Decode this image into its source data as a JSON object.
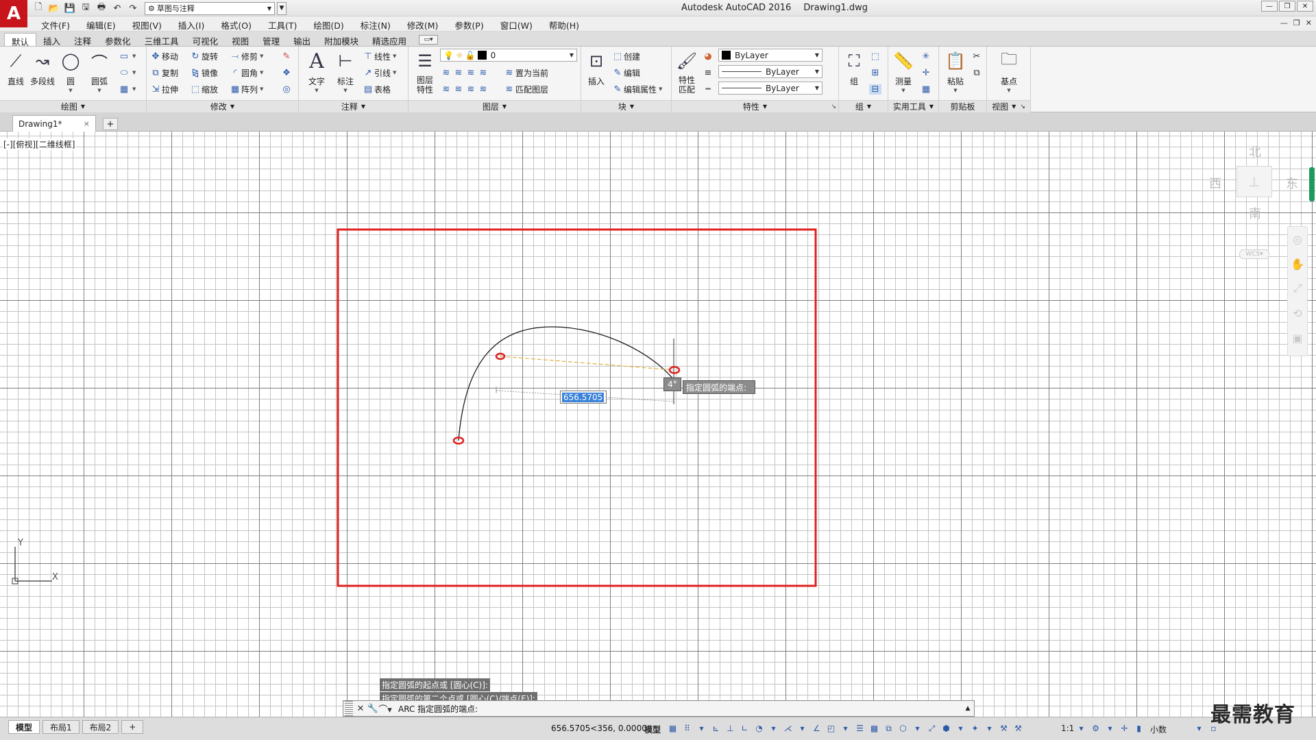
{
  "app": {
    "logo": "A",
    "title_app": "Autodesk AutoCAD 2016",
    "title_file": "Drawing1.dwg",
    "workspace": "草图与注释"
  },
  "menus": [
    "文件(F)",
    "编辑(E)",
    "视图(V)",
    "插入(I)",
    "格式(O)",
    "工具(T)",
    "绘图(D)",
    "标注(N)",
    "修改(M)",
    "参数(P)",
    "窗口(W)",
    "帮助(H)"
  ],
  "ribbon_tabs": [
    "默认",
    "插入",
    "注释",
    "参数化",
    "三维工具",
    "可视化",
    "视图",
    "管理",
    "输出",
    "附加模块",
    "精选应用"
  ],
  "ribbon": {
    "draw": {
      "title": "绘图",
      "line": "直线",
      "polyline": "多段线",
      "circle": "圆",
      "arc": "圆弧"
    },
    "modify": {
      "title": "修改",
      "move": "移动",
      "rotate": "旋转",
      "trim": "修剪",
      "copy": "复制",
      "mirror": "镜像",
      "fillet": "圆角",
      "stretch": "拉伸",
      "scale": "缩放",
      "array": "阵列"
    },
    "annotation": {
      "title": "注释",
      "text": "文字",
      "dimension": "标注",
      "linear": "线性",
      "leader": "引线",
      "table": "表格"
    },
    "layers": {
      "title": "图层",
      "properties_line1": "图层",
      "properties_line2": "特性",
      "current_layer": "0",
      "set_current": "置为当前",
      "match_layer": "匹配图层"
    },
    "block": {
      "title": "块",
      "insert": "插入",
      "create": "创建",
      "edit": "编辑",
      "edit_attr": "编辑属性"
    },
    "properties": {
      "title": "特性",
      "match_line1": "特性",
      "match_line2": "匹配",
      "color": "ByLayer",
      "linetype": "ByLayer",
      "lineweight": "ByLayer"
    },
    "groups": {
      "title": "组",
      "group": "组"
    },
    "utilities": {
      "title": "实用工具",
      "measure": "测量"
    },
    "clipboard": {
      "title": "剪贴板",
      "paste": "粘贴"
    },
    "view": {
      "title": "视图",
      "base": "基点"
    }
  },
  "file_tab": {
    "name": "Drawing1*",
    "close": "×",
    "new": "+"
  },
  "viewport": {
    "label": "[-][俯视][二维线框]",
    "dyn_value": "656.5705",
    "angle": "4°",
    "tooltip": "指定圆弧的端点:"
  },
  "viewcube": {
    "north": "北",
    "south": "南",
    "east": "东",
    "west": "西",
    "wcs": "WCS"
  },
  "ucs": {
    "x": "X",
    "y": "Y"
  },
  "command": {
    "history": [
      "指定圆弧的起点或 [圆心(C)]:",
      "指定圆弧的第二个点或 [圆心(C)/端点(E)]:"
    ],
    "prompt": "ARC 指定圆弧的端点:"
  },
  "status": {
    "layouts": [
      "模型",
      "布局1",
      "布局2"
    ],
    "coords": "656.5705<356, 0.0000",
    "model": "模型",
    "scale": "1:1",
    "units": "小数"
  },
  "watermark": "最需教育",
  "colors": {
    "highlight": "#e02020",
    "accent": "#3b82d9",
    "logo": "#c8141b"
  }
}
